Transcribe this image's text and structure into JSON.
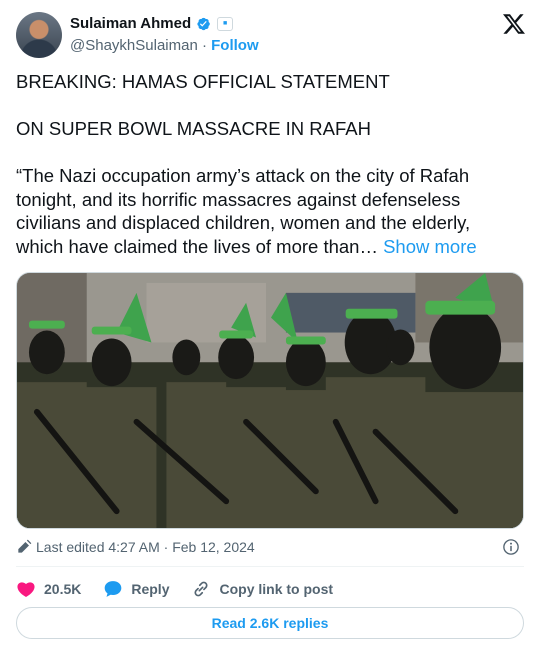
{
  "author": {
    "display_name": "Sulaiman Ahmed",
    "handle": "@ShaykhSulaiman",
    "separator": "·",
    "follow_label": "Follow",
    "verified_icon": "verified-badge-icon",
    "affiliate_icon": "affiliate-badge-icon"
  },
  "platform_icon": "x-logo-icon",
  "tweet": {
    "line1": "BREAKING: HAMAS OFFICIAL STATEMENT",
    "line2": "ON SUPER BOWL MASSACRE IN RAFAH",
    "body": "“The Nazi occupation army’s attack on the city of Rafah tonight, and its horrific massacres against defenseless civilians and displaced children, women and the elderly, which have claimed the lives of more than…",
    "show_more_label": "Show more"
  },
  "media": {
    "icon": "photo-image"
  },
  "meta": {
    "edited_label": "Last edited 4:27 AM · Feb 12, 2024"
  },
  "actions": {
    "likes_count": "20.5K",
    "reply_label": "Reply",
    "copy_link_label": "Copy link to post"
  },
  "read_replies_label": "Read 2.6K replies",
  "colors": {
    "accent": "#1d9bf0",
    "like": "#f91880",
    "text": "#0f1419",
    "secondary": "#536471",
    "border": "#cfd9de"
  }
}
